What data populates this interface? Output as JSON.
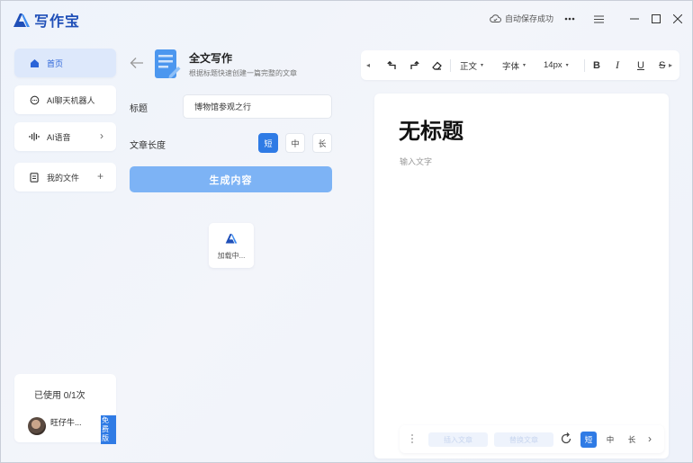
{
  "app": {
    "name": "写作宝",
    "save_status": "自动保存成功"
  },
  "sidebar": {
    "items": [
      {
        "label": "首页",
        "icon": "home-icon",
        "active": true
      },
      {
        "label": "AI聊天机器人",
        "icon": "chat-icon"
      },
      {
        "label": "AI语音",
        "icon": "audio-icon",
        "tail": "›"
      },
      {
        "label": "我的文件",
        "icon": "file-icon",
        "tail": "+"
      }
    ],
    "usage": "已使用 0/1次",
    "user": {
      "name": "旺仔牛...",
      "tag": "免费版"
    }
  },
  "form": {
    "title": "全文写作",
    "subtitle": "根据标题快速创建一篇完整的文章",
    "title_label": "标题",
    "title_value": "博物馆参观之行",
    "length_label": "文章长度",
    "length_options": [
      "短",
      "中",
      "长"
    ],
    "length_selected": "短",
    "generate_label": "生成内容",
    "loading_text": "加载中..."
  },
  "toolbar": {
    "paragraph_style": "正文",
    "font": "字体",
    "font_size": "14px",
    "bold": "B",
    "italic": "I",
    "underline": "U",
    "strike": "S"
  },
  "editor": {
    "doc_title": "无标题",
    "placeholder": "输入文字"
  },
  "bottom_bar": {
    "insert_label": "插入文章",
    "replace_label": "替换文章",
    "length_options": [
      "短",
      "中",
      "长"
    ],
    "length_selected": "短"
  },
  "colors": {
    "accent": "#2f7be5",
    "accent_light": "#7db3f5",
    "brand": "#1f4fb8",
    "active_bg": "#dde8fb"
  }
}
